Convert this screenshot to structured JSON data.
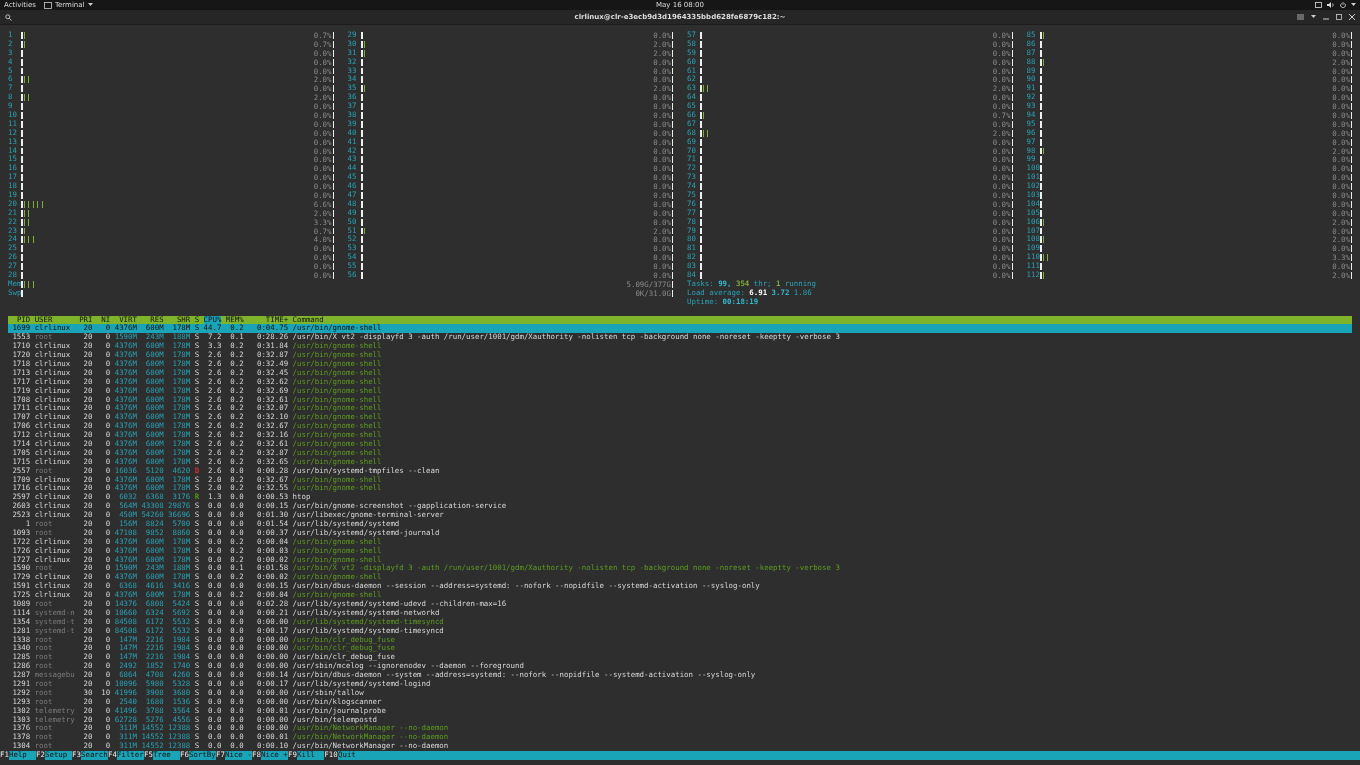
{
  "top_bar": {
    "activities": "Activities",
    "app_menu": "Terminal",
    "clock": "May 16  08:00"
  },
  "window": {
    "title": "clrlinux@clr-e3ecb9d3d1964335bbd628fe6879c182:~"
  },
  "cpu_columns": [
    {
      "meters": [
        {
          "label": "1",
          "level": 0.007,
          "reading": "0.7%"
        },
        {
          "label": "2",
          "level": 0.007,
          "reading": "0.7%"
        },
        {
          "label": "3",
          "level": 0,
          "reading": "0.0%"
        },
        {
          "label": "4",
          "level": 0,
          "reading": "0.0%"
        },
        {
          "label": "5",
          "level": 0,
          "reading": "0.0%"
        },
        {
          "label": "6",
          "level": 0.02,
          "reading": "2.0%"
        },
        {
          "label": "7",
          "level": 0,
          "reading": "0.0%"
        },
        {
          "label": "8",
          "level": 0.02,
          "reading": "2.0%"
        },
        {
          "label": "9",
          "level": 0,
          "reading": "0.0%"
        },
        {
          "label": "10",
          "level": 0,
          "reading": "0.0%"
        },
        {
          "label": "11",
          "level": 0,
          "reading": "0.0%"
        },
        {
          "label": "12",
          "level": 0,
          "reading": "0.0%"
        },
        {
          "label": "13",
          "level": 0,
          "reading": "0.0%"
        },
        {
          "label": "14",
          "level": 0,
          "reading": "0.0%"
        },
        {
          "label": "15",
          "level": 0,
          "reading": "0.0%"
        },
        {
          "label": "16",
          "level": 0,
          "reading": "0.0%"
        },
        {
          "label": "17",
          "level": 0,
          "reading": "0.0%"
        },
        {
          "label": "18",
          "level": 0,
          "reading": "0.0%"
        },
        {
          "label": "19",
          "level": 0,
          "reading": "0.0%"
        },
        {
          "label": "20",
          "level": 0.066,
          "reading": "6.6%"
        },
        {
          "label": "21",
          "level": 0.02,
          "reading": "2.0%"
        },
        {
          "label": "22",
          "level": 0.033,
          "reading": "3.3%"
        },
        {
          "label": "23",
          "level": 0.007,
          "reading": "0.7%"
        },
        {
          "label": "24",
          "level": 0.04,
          "reading": "4.0%"
        },
        {
          "label": "25",
          "level": 0,
          "reading": "0.0%"
        },
        {
          "label": "26",
          "level": 0,
          "reading": "0.0%"
        },
        {
          "label": "27",
          "level": 0,
          "reading": "0.0%"
        },
        {
          "label": "28",
          "level": 0,
          "reading": "0.0%"
        }
      ]
    },
    {
      "meters": [
        {
          "label": "29",
          "level": 0,
          "reading": "0.0%"
        },
        {
          "label": "30",
          "level": 0.02,
          "reading": "2.0%"
        },
        {
          "label": "31",
          "level": 0.02,
          "reading": "2.0%"
        },
        {
          "label": "32",
          "level": 0,
          "reading": "0.0%"
        },
        {
          "label": "33",
          "level": 0,
          "reading": "0.0%"
        },
        {
          "label": "34",
          "level": 0,
          "reading": "0.0%"
        },
        {
          "label": "35",
          "level": 0.02,
          "reading": "2.0%"
        },
        {
          "label": "36",
          "level": 0,
          "reading": "0.0%"
        },
        {
          "label": "37",
          "level": 0,
          "reading": "0.0%"
        },
        {
          "label": "38",
          "level": 0,
          "reading": "0.0%"
        },
        {
          "label": "39",
          "level": 0,
          "reading": "0.0%"
        },
        {
          "label": "40",
          "level": 0,
          "reading": "0.0%"
        },
        {
          "label": "41",
          "level": 0,
          "reading": "0.0%"
        },
        {
          "label": "42",
          "level": 0,
          "reading": "0.0%"
        },
        {
          "label": "43",
          "level": 0,
          "reading": "0.0%"
        },
        {
          "label": "44",
          "level": 0,
          "reading": "0.0%"
        },
        {
          "label": "45",
          "level": 0,
          "reading": "0.0%"
        },
        {
          "label": "46",
          "level": 0,
          "reading": "0.0%"
        },
        {
          "label": "47",
          "level": 0,
          "reading": "0.0%"
        },
        {
          "label": "48",
          "level": 0,
          "reading": "0.0%"
        },
        {
          "label": "49",
          "level": 0,
          "reading": "0.0%"
        },
        {
          "label": "50",
          "level": 0,
          "reading": "0.0%"
        },
        {
          "label": "51",
          "level": 0.02,
          "reading": "2.0%"
        },
        {
          "label": "52",
          "level": 0,
          "reading": "0.0%"
        },
        {
          "label": "53",
          "level": 0,
          "reading": "0.0%"
        },
        {
          "label": "54",
          "level": 0,
          "reading": "0.0%"
        },
        {
          "label": "55",
          "level": 0,
          "reading": "0.0%"
        },
        {
          "label": "56",
          "level": 0,
          "reading": "0.0%"
        }
      ]
    },
    {
      "meters": [
        {
          "label": "57",
          "level": 0,
          "reading": "0.0%"
        },
        {
          "label": "58",
          "level": 0,
          "reading": "0.0%"
        },
        {
          "label": "59",
          "level": 0,
          "reading": "0.0%"
        },
        {
          "label": "60",
          "level": 0,
          "reading": "0.0%"
        },
        {
          "label": "61",
          "level": 0,
          "reading": "0.0%"
        },
        {
          "label": "62",
          "level": 0,
          "reading": "0.0%"
        },
        {
          "label": "63",
          "level": 0.02,
          "reading": "2.0%"
        },
        {
          "label": "64",
          "level": 0,
          "reading": "0.0%"
        },
        {
          "label": "65",
          "level": 0,
          "reading": "0.0%"
        },
        {
          "label": "66",
          "level": 0.007,
          "reading": "0.7%"
        },
        {
          "label": "67",
          "level": 0,
          "reading": "0.0%"
        },
        {
          "label": "68",
          "level": 0.02,
          "reading": "2.0%"
        },
        {
          "label": "69",
          "level": 0,
          "reading": "0.0%"
        },
        {
          "label": "70",
          "level": 0,
          "reading": "0.0%"
        },
        {
          "label": "71",
          "level": 0,
          "reading": "0.0%"
        },
        {
          "label": "72",
          "level": 0,
          "reading": "0.0%"
        },
        {
          "label": "73",
          "level": 0,
          "reading": "0.0%"
        },
        {
          "label": "74",
          "level": 0,
          "reading": "0.0%"
        },
        {
          "label": "75",
          "level": 0,
          "reading": "0.0%"
        },
        {
          "label": "76",
          "level": 0,
          "reading": "0.0%"
        },
        {
          "label": "77",
          "level": 0,
          "reading": "0.0%"
        },
        {
          "label": "78",
          "level": 0,
          "reading": "0.0%"
        },
        {
          "label": "79",
          "level": 0,
          "reading": "0.0%"
        },
        {
          "label": "80",
          "level": 0,
          "reading": "0.0%"
        },
        {
          "label": "81",
          "level": 0,
          "reading": "0.0%"
        },
        {
          "label": "82",
          "level": 0,
          "reading": "0.0%"
        },
        {
          "label": "83",
          "level": 0,
          "reading": "0.0%"
        },
        {
          "label": "84",
          "level": 0,
          "reading": "0.0%"
        }
      ]
    },
    {
      "meters": [
        {
          "label": "85",
          "level": 0.02,
          "reading": "0.0%"
        },
        {
          "label": "86",
          "level": 0,
          "reading": "0.0%"
        },
        {
          "label": "87",
          "level": 0,
          "reading": "0.0%"
        },
        {
          "label": "88",
          "level": 0.02,
          "reading": "2.0%"
        },
        {
          "label": "89",
          "level": 0,
          "reading": "0.0%"
        },
        {
          "label": "90",
          "level": 0,
          "reading": "0.0%"
        },
        {
          "label": "91",
          "level": 0,
          "reading": "0.0%"
        },
        {
          "label": "92",
          "level": 0,
          "reading": "0.0%"
        },
        {
          "label": "93",
          "level": 0,
          "reading": "0.0%"
        },
        {
          "label": "94",
          "level": 0,
          "reading": "0.0%"
        },
        {
          "label": "95",
          "level": 0,
          "reading": "0.0%"
        },
        {
          "label": "96",
          "level": 0,
          "reading": "0.0%"
        },
        {
          "label": "97",
          "level": 0,
          "reading": "0.0%"
        },
        {
          "label": "98",
          "level": 0.02,
          "reading": "2.0%"
        },
        {
          "label": "99",
          "level": 0,
          "reading": "0.0%"
        },
        {
          "label": "100",
          "level": 0,
          "reading": "0.0%"
        },
        {
          "label": "101",
          "level": 0,
          "reading": "0.0%"
        },
        {
          "label": "102",
          "level": 0,
          "reading": "0.0%"
        },
        {
          "label": "103",
          "level": 0,
          "reading": "0.0%"
        },
        {
          "label": "104",
          "level": 0,
          "reading": "0.0%"
        },
        {
          "label": "105",
          "level": 0,
          "reading": "0.0%"
        },
        {
          "label": "106",
          "level": 0.02,
          "reading": "2.0%"
        },
        {
          "label": "107",
          "level": 0,
          "reading": "0.0%"
        },
        {
          "label": "108",
          "level": 0.02,
          "reading": "2.0%"
        },
        {
          "label": "109",
          "level": 0,
          "reading": "0.0%"
        },
        {
          "label": "110",
          "level": 0.033,
          "reading": "3.3%"
        },
        {
          "label": "111",
          "level": 0,
          "reading": "0.0%"
        },
        {
          "label": "112",
          "level": 0.02,
          "reading": "2.0%"
        }
      ]
    }
  ],
  "memory": [
    {
      "label": "Mem",
      "level": 0.02,
      "reading": "5.09G/377G"
    },
    {
      "label": "Swp",
      "level": 0,
      "reading": "0K/31.0G"
    }
  ],
  "tasks": {
    "label": "Tasks:",
    "count": "99,",
    "threads": "354",
    "threads_label": "thr;",
    "running": "1",
    "running_label": "running"
  },
  "load": {
    "label": "Load average:",
    "one": "6.91",
    "five": "3.72",
    "fifteen": "1.86"
  },
  "uptime": {
    "label": "Uptime:",
    "value": "00:18:19"
  },
  "columns": [
    {
      "label": "PID",
      "sorted": false
    },
    {
      "label": "USER",
      "sorted": false
    },
    {
      "label": "PRI",
      "sorted": false
    },
    {
      "label": "NI",
      "sorted": false
    },
    {
      "label": "VIRT",
      "sorted": false
    },
    {
      "label": "RES",
      "sorted": false
    },
    {
      "label": "SHR",
      "sorted": false
    },
    {
      "label": "S",
      "sorted": false
    },
    {
      "label": "CPU%",
      "sorted": true
    },
    {
      "label": "MEM%",
      "sorted": false
    },
    {
      "label": "TIME+",
      "sorted": false
    },
    {
      "label": "Command",
      "sorted": false
    }
  ],
  "processes": [
    {
      "pid": "1699",
      "user": "clrlinux",
      "own": true,
      "pri": "20",
      "ni": "0",
      "virt": "4376M",
      "res": "600M",
      "shr": "178M",
      "state": "S",
      "cpu": "44.7",
      "mem": "0.2",
      "time": "0:04.75",
      "command": "/usr/bin/gnome-shell",
      "thread": false,
      "selected": true
    },
    {
      "pid": "1553",
      "user": "root",
      "own": false,
      "pri": "20",
      "ni": "0",
      "virt": "1590M",
      "res": "243M",
      "shr": "188M",
      "state": "S",
      "cpu": "7.2",
      "mem": "0.1",
      "time": "0:28.26",
      "command": "/usr/bin/X vt2 -displayfd 3 -auth /run/user/1001/gdm/Xauthority -nolisten tcp -background none -noreset -keeptty -verbose 3",
      "thread": false,
      "selected": false
    },
    {
      "pid": "1710",
      "user": "clrlinux",
      "own": true,
      "pri": "20",
      "ni": "0",
      "virt": "4376M",
      "res": "600M",
      "shr": "178M",
      "state": "S",
      "cpu": "3.3",
      "mem": "0.2",
      "time": "0:31.84",
      "command": "/usr/bin/gnome-shell",
      "thread": true,
      "selected": false
    },
    {
      "pid": "1720",
      "user": "clrlinux",
      "own": true,
      "pri": "20",
      "ni": "0",
      "virt": "4376M",
      "res": "600M",
      "shr": "178M",
      "state": "S",
      "cpu": "2.6",
      "mem": "0.2",
      "time": "0:32.87",
      "command": "/usr/bin/gnome-shell",
      "thread": true,
      "selected": false
    },
    {
      "pid": "1718",
      "user": "clrlinux",
      "own": true,
      "pri": "20",
      "ni": "0",
      "virt": "4376M",
      "res": "600M",
      "shr": "178M",
      "state": "S",
      "cpu": "2.6",
      "mem": "0.2",
      "time": "0:32.49",
      "command": "/usr/bin/gnome-shell",
      "thread": true,
      "selected": false
    },
    {
      "pid": "1713",
      "user": "clrlinux",
      "own": true,
      "pri": "20",
      "ni": "0",
      "virt": "4376M",
      "res": "600M",
      "shr": "178M",
      "state": "S",
      "cpu": "2.6",
      "mem": "0.2",
      "time": "0:32.45",
      "command": "/usr/bin/gnome-shell",
      "thread": true,
      "selected": false
    },
    {
      "pid": "1717",
      "user": "clrlinux",
      "own": true,
      "pri": "20",
      "ni": "0",
      "virt": "4376M",
      "res": "600M",
      "shr": "178M",
      "state": "S",
      "cpu": "2.6",
      "mem": "0.2",
      "time": "0:32.62",
      "command": "/usr/bin/gnome-shell",
      "thread": true,
      "selected": false
    },
    {
      "pid": "1719",
      "user": "clrlinux",
      "own": true,
      "pri": "20",
      "ni": "0",
      "virt": "4376M",
      "res": "600M",
      "shr": "178M",
      "state": "S",
      "cpu": "2.6",
      "mem": "0.2",
      "time": "0:32.69",
      "command": "/usr/bin/gnome-shell",
      "thread": true,
      "selected": false
    },
    {
      "pid": "1708",
      "user": "clrlinux",
      "own": true,
      "pri": "20",
      "ni": "0",
      "virt": "4376M",
      "res": "600M",
      "shr": "178M",
      "state": "S",
      "cpu": "2.6",
      "mem": "0.2",
      "time": "0:32.61",
      "command": "/usr/bin/gnome-shell",
      "thread": true,
      "selected": false
    },
    {
      "pid": "1711",
      "user": "clrlinux",
      "own": true,
      "pri": "20",
      "ni": "0",
      "virt": "4376M",
      "res": "600M",
      "shr": "178M",
      "state": "S",
      "cpu": "2.6",
      "mem": "0.2",
      "time": "0:32.07",
      "command": "/usr/bin/gnome-shell",
      "thread": true,
      "selected": false
    },
    {
      "pid": "1707",
      "user": "clrlinux",
      "own": true,
      "pri": "20",
      "ni": "0",
      "virt": "4376M",
      "res": "600M",
      "shr": "178M",
      "state": "S",
      "cpu": "2.6",
      "mem": "0.2",
      "time": "0:32.10",
      "command": "/usr/bin/gnome-shell",
      "thread": true,
      "selected": false
    },
    {
      "pid": "1706",
      "user": "clrlinux",
      "own": true,
      "pri": "20",
      "ni": "0",
      "virt": "4376M",
      "res": "600M",
      "shr": "178M",
      "state": "S",
      "cpu": "2.6",
      "mem": "0.2",
      "time": "0:32.67",
      "command": "/usr/bin/gnome-shell",
      "thread": true,
      "selected": false
    },
    {
      "pid": "1712",
      "user": "clrlinux",
      "own": true,
      "pri": "20",
      "ni": "0",
      "virt": "4376M",
      "res": "600M",
      "shr": "178M",
      "state": "S",
      "cpu": "2.6",
      "mem": "0.2",
      "time": "0:32.16",
      "command": "/usr/bin/gnome-shell",
      "thread": true,
      "selected": false
    },
    {
      "pid": "1714",
      "user": "clrlinux",
      "own": true,
      "pri": "20",
      "ni": "0",
      "virt": "4376M",
      "res": "600M",
      "shr": "178M",
      "state": "S",
      "cpu": "2.6",
      "mem": "0.2",
      "time": "0:32.61",
      "command": "/usr/bin/gnome-shell",
      "thread": true,
      "selected": false
    },
    {
      "pid": "1705",
      "user": "clrlinux",
      "own": true,
      "pri": "20",
      "ni": "0",
      "virt": "4376M",
      "res": "600M",
      "shr": "178M",
      "state": "S",
      "cpu": "2.6",
      "mem": "0.2",
      "time": "0:32.87",
      "command": "/usr/bin/gnome-shell",
      "thread": true,
      "selected": false
    },
    {
      "pid": "1715",
      "user": "clrlinux",
      "own": true,
      "pri": "20",
      "ni": "0",
      "virt": "4376M",
      "res": "600M",
      "shr": "178M",
      "state": "S",
      "cpu": "2.6",
      "mem": "0.2",
      "time": "0:32.65",
      "command": "/usr/bin/gnome-shell",
      "thread": true,
      "selected": false
    },
    {
      "pid": "2557",
      "user": "root",
      "own": false,
      "pri": "20",
      "ni": "0",
      "virt": "16036",
      "res": "5120",
      "shr": "4620",
      "state": "D",
      "color": "#d03030",
      "cpu": "2.6",
      "mem": "0.0",
      "time": "0:00.28",
      "command": "/usr/bin/systemd-tmpfiles --clean",
      "thread": false,
      "selected": false
    },
    {
      "pid": "1709",
      "user": "clrlinux",
      "own": true,
      "pri": "20",
      "ni": "0",
      "virt": "4376M",
      "res": "600M",
      "shr": "178M",
      "state": "S",
      "cpu": "2.0",
      "mem": "0.2",
      "time": "0:32.67",
      "command": "/usr/bin/gnome-shell",
      "thread": true,
      "selected": false
    },
    {
      "pid": "1716",
      "user": "clrlinux",
      "own": true,
      "pri": "20",
      "ni": "0",
      "virt": "4376M",
      "res": "600M",
      "shr": "178M",
      "state": "S",
      "cpu": "2.0",
      "mem": "0.2",
      "time": "0:32.55",
      "command": "/usr/bin/gnome-shell",
      "thread": true,
      "selected": false
    },
    {
      "pid": "2597",
      "user": "clrlinux",
      "own": true,
      "pri": "20",
      "ni": "0",
      "virt": "6032",
      "res": "6368",
      "shr": "3176",
      "state": "R",
      "color": "#4e9a06",
      "cpu": "1.3",
      "mem": "0.0",
      "time": "0:00.53",
      "command": "htop",
      "thread": false,
      "selected": false
    },
    {
      "pid": "2603",
      "user": "clrlinux",
      "own": true,
      "pri": "20",
      "ni": "0",
      "virt": "564M",
      "res": "43308",
      "shr": "29876",
      "state": "S",
      "cpu": "0.0",
      "mem": "0.0",
      "time": "0:00.15",
      "command": "/usr/bin/gnome-screenshot --gapplication-service",
      "thread": false,
      "selected": false
    },
    {
      "pid": "2523",
      "user": "clrlinux",
      "own": true,
      "pri": "20",
      "ni": "0",
      "virt": "450M",
      "res": "54260",
      "shr": "36696",
      "state": "S",
      "cpu": "0.0",
      "mem": "0.0",
      "time": "0:01.30",
      "command": "/usr/libexec/gnome-terminal-server",
      "thread": false,
      "selected": false
    },
    {
      "pid": "1",
      "user": "root",
      "own": false,
      "pri": "20",
      "ni": "0",
      "virt": "156M",
      "res": "8824",
      "shr": "5700",
      "state": "S",
      "cpu": "0.0",
      "mem": "0.0",
      "time": "0:01.54",
      "command": "/usr/lib/systemd/systemd",
      "thread": false,
      "selected": false
    },
    {
      "pid": "1093",
      "user": "root",
      "own": false,
      "pri": "20",
      "ni": "0",
      "virt": "47108",
      "res": "9852",
      "shr": "8860",
      "state": "S",
      "cpu": "0.0",
      "mem": "0.0",
      "time": "0:00.37",
      "command": "/usr/lib/systemd/systemd-journald",
      "thread": false,
      "selected": false
    },
    {
      "pid": "1722",
      "user": "clrlinux",
      "own": true,
      "pri": "20",
      "ni": "0",
      "virt": "4376M",
      "res": "600M",
      "shr": "178M",
      "state": "S",
      "cpu": "0.0",
      "mem": "0.2",
      "time": "0:00.04",
      "command": "/usr/bin/gnome-shell",
      "thread": true,
      "selected": false
    },
    {
      "pid": "1726",
      "user": "clrlinux",
      "own": true,
      "pri": "20",
      "ni": "0",
      "virt": "4376M",
      "res": "600M",
      "shr": "178M",
      "state": "S",
      "cpu": "0.0",
      "mem": "0.2",
      "time": "0:00.03",
      "command": "/usr/bin/gnome-shell",
      "thread": true,
      "selected": false
    },
    {
      "pid": "1727",
      "user": "clrlinux",
      "own": true,
      "pri": "20",
      "ni": "0",
      "virt": "4376M",
      "res": "600M",
      "shr": "178M",
      "state": "S",
      "cpu": "0.0",
      "mem": "0.2",
      "time": "0:00.02",
      "command": "/usr/bin/gnome-shell",
      "thread": true,
      "selected": false
    },
    {
      "pid": "1590",
      "user": "root",
      "own": false,
      "pri": "20",
      "ni": "0",
      "virt": "1590M",
      "res": "243M",
      "shr": "188M",
      "state": "S",
      "cpu": "0.0",
      "mem": "0.1",
      "time": "0:01.58",
      "command": "/usr/bin/X vt2 -displayfd 3 -auth /run/user/1001/gdm/Xauthority -nolisten tcp -background none -noreset -keeptty -verbose 3",
      "thread": true,
      "selected": false
    },
    {
      "pid": "1729",
      "user": "clrlinux",
      "own": true,
      "pri": "20",
      "ni": "0",
      "virt": "4376M",
      "res": "600M",
      "shr": "178M",
      "state": "S",
      "cpu": "0.0",
      "mem": "0.2",
      "time": "0:00.02",
      "command": "/usr/bin/gnome-shell",
      "thread": true,
      "selected": false
    },
    {
      "pid": "1591",
      "user": "clrlinux",
      "own": true,
      "pri": "20",
      "ni": "0",
      "virt": "6368",
      "res": "4616",
      "shr": "3416",
      "state": "S",
      "cpu": "0.0",
      "mem": "0.0",
      "time": "0:00.15",
      "command": "/usr/bin/dbus-daemon --session --address=systemd: --nofork --nopidfile --systemd-activation --syslog-only",
      "thread": false,
      "selected": false
    },
    {
      "pid": "1725",
      "user": "clrlinux",
      "own": true,
      "pri": "20",
      "ni": "0",
      "virt": "4376M",
      "res": "600M",
      "shr": "178M",
      "state": "S",
      "cpu": "0.0",
      "mem": "0.2",
      "time": "0:00.04",
      "command": "/usr/bin/gnome-shell",
      "thread": true,
      "selected": false
    },
    {
      "pid": "1089",
      "user": "root",
      "own": false,
      "pri": "20",
      "ni": "0",
      "virt": "14376",
      "res": "6808",
      "shr": "5424",
      "state": "S",
      "cpu": "0.0",
      "mem": "0.0",
      "time": "0:02.28",
      "command": "/usr/lib/systemd/systemd-udevd --children-max=16",
      "thread": false,
      "selected": false
    },
    {
      "pid": "1114",
      "user": "systemd-n",
      "own": false,
      "pri": "20",
      "ni": "0",
      "virt": "10660",
      "res": "6324",
      "shr": "5692",
      "state": "S",
      "cpu": "0.0",
      "mem": "0.0",
      "time": "0:00.21",
      "command": "/usr/lib/systemd/systemd-networkd",
      "thread": false,
      "selected": false
    },
    {
      "pid": "1354",
      "user": "systemd-t",
      "own": false,
      "pri": "20",
      "ni": "0",
      "virt": "84508",
      "res": "6172",
      "shr": "5532",
      "state": "S",
      "cpu": "0.0",
      "mem": "0.0",
      "time": "0:00.00",
      "command": "/usr/lib/systemd/systemd-timesyncd",
      "thread": true,
      "selected": false
    },
    {
      "pid": "1281",
      "user": "systemd-t",
      "own": false,
      "pri": "20",
      "ni": "0",
      "virt": "84508",
      "res": "6172",
      "shr": "5532",
      "state": "S",
      "cpu": "0.0",
      "mem": "0.0",
      "time": "0:00.17",
      "command": "/usr/lib/systemd/systemd-timesyncd",
      "thread": false,
      "selected": false
    },
    {
      "pid": "1338",
      "user": "root",
      "own": false,
      "pri": "20",
      "ni": "0",
      "virt": "147M",
      "res": "2216",
      "shr": "1984",
      "state": "S",
      "cpu": "0.0",
      "mem": "0.0",
      "time": "0:00.00",
      "command": "/usr/bin/clr_debug_fuse",
      "thread": true,
      "selected": false
    },
    {
      "pid": "1340",
      "user": "root",
      "own": false,
      "pri": "20",
      "ni": "0",
      "virt": "147M",
      "res": "2216",
      "shr": "1984",
      "state": "S",
      "cpu": "0.0",
      "mem": "0.0",
      "time": "0:00.00",
      "command": "/usr/bin/clr_debug_fuse",
      "thread": true,
      "selected": false
    },
    {
      "pid": "1285",
      "user": "root",
      "own": false,
      "pri": "20",
      "ni": "0",
      "virt": "147M",
      "res": "2216",
      "shr": "1984",
      "state": "S",
      "cpu": "0.0",
      "mem": "0.0",
      "time": "0:00.00",
      "command": "/usr/bin/clr_debug_fuse",
      "thread": false,
      "selected": false
    },
    {
      "pid": "1286",
      "user": "root",
      "own": false,
      "pri": "20",
      "ni": "0",
      "virt": "2492",
      "res": "1852",
      "shr": "1740",
      "state": "S",
      "cpu": "0.0",
      "mem": "0.0",
      "time": "0:00.00",
      "command": "/usr/sbin/mcelog --ignorenodev --daemon --foreground",
      "thread": false,
      "selected": false
    },
    {
      "pid": "1287",
      "user": "messagebu",
      "own": false,
      "pri": "20",
      "ni": "0",
      "virt": "6864",
      "res": "4708",
      "shr": "4260",
      "state": "S",
      "cpu": "0.0",
      "mem": "0.0",
      "time": "0:00.14",
      "command": "/usr/bin/dbus-daemon --system --address=systemd: --nofork --nopidfile --systemd-activation --syslog-only",
      "thread": false,
      "selected": false
    },
    {
      "pid": "1291",
      "user": "root",
      "own": false,
      "pri": "20",
      "ni": "0",
      "virt": "10096",
      "res": "5980",
      "shr": "5328",
      "state": "S",
      "cpu": "0.0",
      "mem": "0.0",
      "time": "0:00.17",
      "command": "/usr/lib/systemd/systemd-logind",
      "thread": false,
      "selected": false
    },
    {
      "pid": "1292",
      "user": "root",
      "own": false,
      "pri": "30",
      "ni": "10",
      "virt": "41996",
      "res": "3908",
      "shr": "3680",
      "state": "S",
      "cpu": "0.0",
      "mem": "0.0",
      "time": "0:00.00",
      "command": "/usr/sbin/tallow",
      "thread": false,
      "selected": false
    },
    {
      "pid": "1293",
      "user": "root",
      "own": false,
      "pri": "20",
      "ni": "0",
      "virt": "2540",
      "res": "1680",
      "shr": "1536",
      "state": "S",
      "cpu": "0.0",
      "mem": "0.0",
      "time": "0:00.00",
      "command": "/usr/bin/klogscanner",
      "thread": false,
      "selected": false
    },
    {
      "pid": "1302",
      "user": "telemetry",
      "own": false,
      "pri": "20",
      "ni": "0",
      "virt": "41496",
      "res": "3788",
      "shr": "3564",
      "state": "S",
      "cpu": "0.0",
      "mem": "0.0",
      "time": "0:00.01",
      "command": "/usr/bin/journalprobe",
      "thread": false,
      "selected": false
    },
    {
      "pid": "1303",
      "user": "telemetry",
      "own": false,
      "pri": "20",
      "ni": "0",
      "virt": "62728",
      "res": "5276",
      "shr": "4556",
      "state": "S",
      "cpu": "0.0",
      "mem": "0.0",
      "time": "0:00.00",
      "command": "/usr/bin/telempostd",
      "thread": false,
      "selected": false
    },
    {
      "pid": "1376",
      "user": "root",
      "own": false,
      "pri": "20",
      "ni": "0",
      "virt": "311M",
      "res": "14552",
      "shr": "12388",
      "state": "S",
      "cpu": "0.0",
      "mem": "0.0",
      "time": "0:00.00",
      "command": "/usr/bin/NetworkManager --no-daemon",
      "thread": true,
      "selected": false
    },
    {
      "pid": "1378",
      "user": "root",
      "own": false,
      "pri": "20",
      "ni": "0",
      "virt": "311M",
      "res": "14552",
      "shr": "12388",
      "state": "S",
      "cpu": "0.0",
      "mem": "0.0",
      "time": "0:00.01",
      "command": "/usr/bin/NetworkManager --no-daemon",
      "thread": true,
      "selected": false
    },
    {
      "pid": "1304",
      "user": "root",
      "own": false,
      "pri": "20",
      "ni": "0",
      "virt": "311M",
      "res": "14552",
      "shr": "12388",
      "state": "S",
      "cpu": "0.0",
      "mem": "0.0",
      "time": "0:00.10",
      "command": "/usr/bin/NetworkManager --no-daemon",
      "thread": false,
      "selected": false
    }
  ],
  "function_keys": [
    {
      "key": "F1",
      "label": "Help"
    },
    {
      "key": "F2",
      "label": "Setup"
    },
    {
      "key": "F3",
      "label": "Search"
    },
    {
      "key": "F4",
      "label": "Filter"
    },
    {
      "key": "F5",
      "label": "Tree"
    },
    {
      "key": "F6",
      "label": "SortBy"
    },
    {
      "key": "F7",
      "label": "Nice -"
    },
    {
      "key": "F8",
      "label": "Nice +"
    },
    {
      "key": "F9",
      "label": "Kill"
    },
    {
      "key": "F10",
      "label": "Quit"
    }
  ]
}
